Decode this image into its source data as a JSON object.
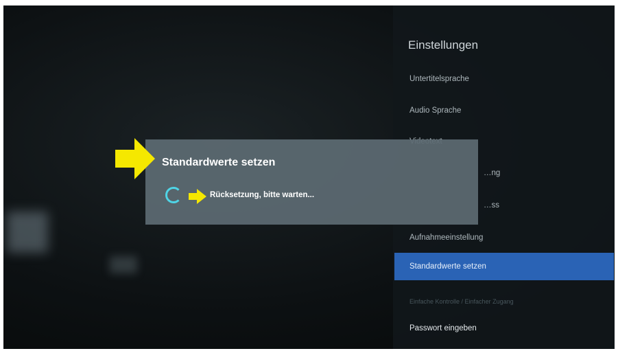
{
  "settings": {
    "title": "Einstellungen",
    "items": [
      {
        "label": "Untertitelsprache"
      },
      {
        "label": "Audio Sprache"
      },
      {
        "label": "Videotext"
      },
      {
        "label": "…ng"
      },
      {
        "label": "…ss"
      },
      {
        "label": "Aufnahmeeinstellung"
      },
      {
        "label": "Standardwerte setzen"
      },
      {
        "label": "Einfache Kontrolle / Einfacher Zugang"
      },
      {
        "label": "Passwort eingeben"
      }
    ],
    "selected_index": 6
  },
  "dialog": {
    "title": "Standardwerte setzen",
    "status": "Rücksetzung, bitte warten..."
  },
  "colors": {
    "selection": "#2a63b5",
    "spinner": "#4fd4e6",
    "annotation_arrow": "#f5e800"
  },
  "icons": {
    "spinner": "loading-spinner-icon",
    "annotation": "arrow-right-icon"
  }
}
